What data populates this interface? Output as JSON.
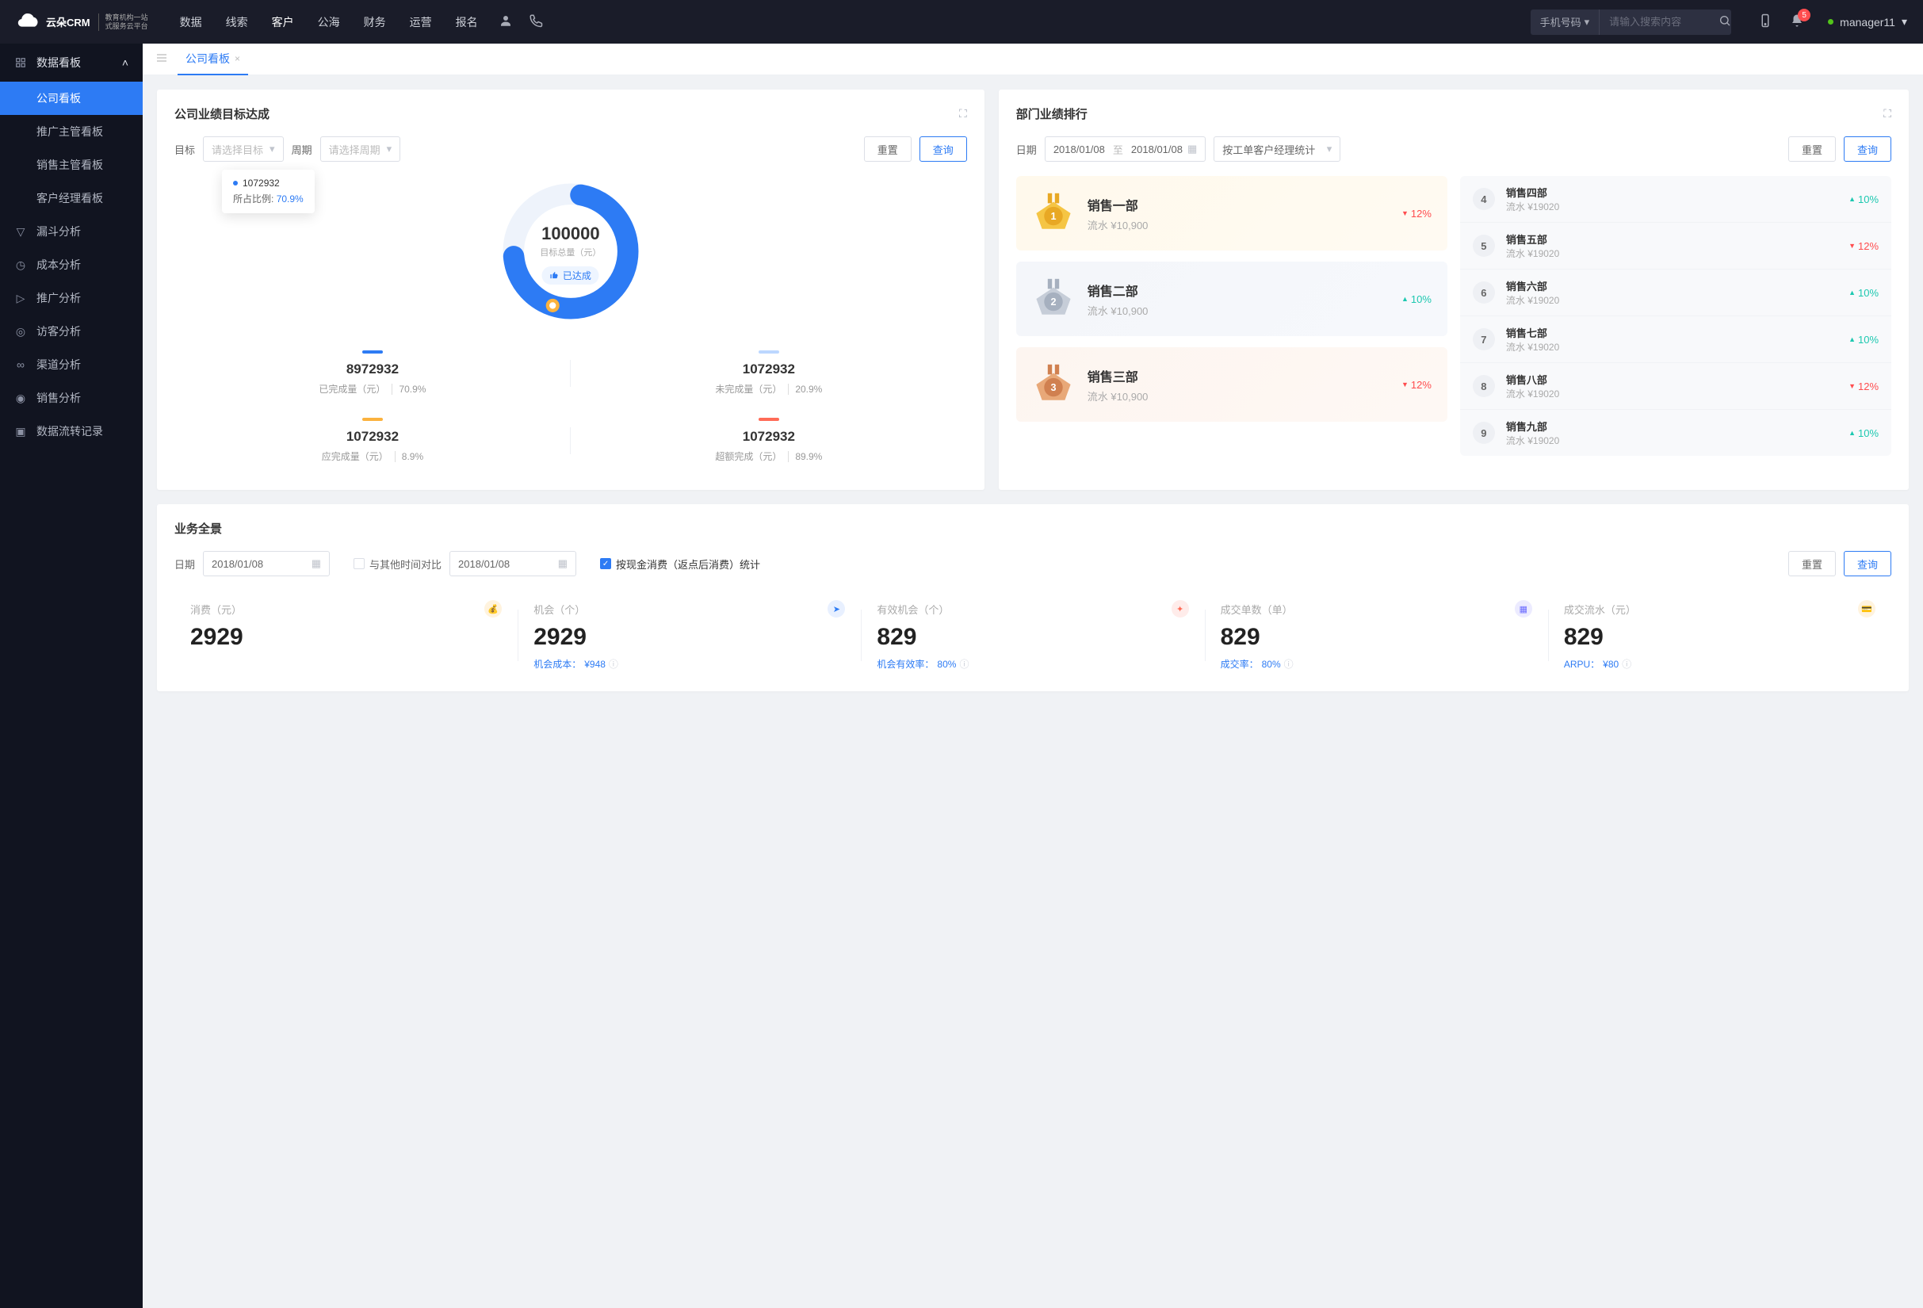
{
  "brand": {
    "name": "云朵CRM",
    "sub1": "教育机构一站",
    "sub2": "式服务云平台"
  },
  "nav": {
    "items": [
      "数据",
      "线索",
      "客户",
      "公海",
      "财务",
      "运营",
      "报名"
    ],
    "activeIndex": 2
  },
  "search": {
    "type": "手机号码",
    "placeholder": "请输入搜索内容"
  },
  "notif": {
    "count": "5"
  },
  "user": {
    "name": "manager11"
  },
  "sidebar": {
    "section_title": "数据看板",
    "subs": [
      "公司看板",
      "推广主管看板",
      "销售主管看板",
      "客户经理看板"
    ],
    "items": [
      "漏斗分析",
      "成本分析",
      "推广分析",
      "访客分析",
      "渠道分析",
      "销售分析",
      "数据流转记录"
    ]
  },
  "tabs": {
    "active_label": "公司看板"
  },
  "card1": {
    "title": "公司业绩目标达成",
    "target_label": "目标",
    "target_placeholder": "请选择目标",
    "period_label": "周期",
    "period_placeholder": "请选择周期",
    "reset": "重置",
    "query": "查询",
    "tooltip_value": "1072932",
    "tooltip_ratio_label": "所占比例:",
    "tooltip_ratio": "70.9%",
    "center_value": "100000",
    "center_label": "目标总量（元）",
    "reached_text": "已达成",
    "stats": [
      {
        "bar": "#2d7bf4",
        "value": "8972932",
        "label": "已完成量（元）",
        "pct": "70.9%"
      },
      {
        "bar": "#bcd7ff",
        "value": "1072932",
        "label": "未完成量（元）",
        "pct": "20.9%"
      },
      {
        "bar": "#fbb23e",
        "value": "1072932",
        "label": "应完成量（元）",
        "pct": "8.9%"
      },
      {
        "bar": "#ff6b57",
        "value": "1072932",
        "label": "超额完成（元）",
        "pct": "89.9%"
      }
    ]
  },
  "chart_data": {
    "type": "pie",
    "title": "公司业绩目标达成",
    "total_label": "目标总量（元）",
    "total": 100000,
    "series": [
      {
        "name": "已完成量（元）",
        "value": 8972932,
        "pct": 70.9,
        "color": "#2d7bf4"
      },
      {
        "name": "未完成量（元）",
        "value": 1072932,
        "pct": 20.9,
        "color": "#bcd7ff"
      },
      {
        "name": "应完成量（元）",
        "value": 1072932,
        "pct": 8.9,
        "color": "#fbb23e"
      },
      {
        "name": "超额完成（元）",
        "value": 1072932,
        "pct": 89.9,
        "color": "#ff6b57"
      }
    ]
  },
  "card2": {
    "title": "部门业绩排行",
    "date_label": "日期",
    "date_from": "2018/01/08",
    "date_to": "2018/01/08",
    "date_sep": "至",
    "group_by": "按工单客户经理统计",
    "reset": "重置",
    "query": "查询",
    "podium": [
      {
        "rank": "1",
        "type": "gold",
        "name": "销售一部",
        "flow": "流水 ¥10,900",
        "trend_dir": "down",
        "trend": "12%"
      },
      {
        "rank": "2",
        "type": "silver",
        "name": "销售二部",
        "flow": "流水 ¥10,900",
        "trend_dir": "up",
        "trend": "10%"
      },
      {
        "rank": "3",
        "type": "bronze",
        "name": "销售三部",
        "flow": "流水 ¥10,900",
        "trend_dir": "down",
        "trend": "12%"
      }
    ],
    "list": [
      {
        "rank": "4",
        "name": "销售四部",
        "flow": "流水 ¥19020",
        "trend_dir": "up",
        "trend": "10%"
      },
      {
        "rank": "5",
        "name": "销售五部",
        "flow": "流水 ¥19020",
        "trend_dir": "down",
        "trend": "12%"
      },
      {
        "rank": "6",
        "name": "销售六部",
        "flow": "流水 ¥19020",
        "trend_dir": "up",
        "trend": "10%"
      },
      {
        "rank": "7",
        "name": "销售七部",
        "flow": "流水 ¥19020",
        "trend_dir": "up",
        "trend": "10%"
      },
      {
        "rank": "8",
        "name": "销售八部",
        "flow": "流水 ¥19020",
        "trend_dir": "down",
        "trend": "12%"
      },
      {
        "rank": "9",
        "name": "销售九部",
        "flow": "流水 ¥19020",
        "trend_dir": "up",
        "trend": "10%"
      }
    ]
  },
  "card3": {
    "title": "业务全景",
    "date_label": "日期",
    "date1": "2018/01/08",
    "compare_label": "与其他时间对比",
    "date2": "2018/01/08",
    "stat_by_label": "按现金消费（返点后消费）统计",
    "reset": "重置",
    "query": "查询",
    "kpis": [
      {
        "label": "消费（元）",
        "badge": "💰",
        "badge_bg": "#fff3de",
        "badge_fg": "#f0a020",
        "value": "2929",
        "foot_label": "",
        "foot_value": ""
      },
      {
        "label": "机会（个）",
        "badge": "➤",
        "badge_bg": "#e8f0ff",
        "badge_fg": "#2d7bf4",
        "value": "2929",
        "foot_label": "机会成本：",
        "foot_value": "¥948"
      },
      {
        "label": "有效机会（个）",
        "badge": "✦",
        "badge_bg": "#ffecea",
        "badge_fg": "#ff6b57",
        "value": "829",
        "foot_label": "机会有效率：",
        "foot_value": "80%"
      },
      {
        "label": "成交单数（单）",
        "badge": "▦",
        "badge_bg": "#ecebff",
        "badge_fg": "#6c6cff",
        "value": "829",
        "foot_label": "成交率：",
        "foot_value": "80%"
      },
      {
        "label": "成交流水（元）",
        "badge": "💳",
        "badge_bg": "#fff3de",
        "badge_fg": "#f0a020",
        "value": "829",
        "foot_label": "ARPU：",
        "foot_value": "¥80"
      }
    ]
  }
}
